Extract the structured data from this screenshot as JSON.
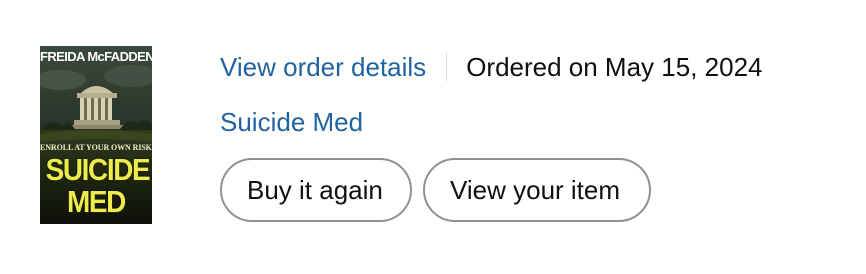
{
  "product": {
    "cover": {
      "author": "FREIDA McFADDEN",
      "tagline": "ENROLL AT YOUR OWN RISK...",
      "title_line1": "SUICIDE",
      "title_line2": "MED"
    },
    "title": "Suicide Med"
  },
  "order": {
    "details_link": "View order details",
    "ordered_on": "Ordered on May 15, 2024"
  },
  "actions": {
    "buy_again": "Buy it again",
    "view_item": "View your item"
  },
  "colors": {
    "link": "#2162a1",
    "text": "#0f1111",
    "button_border": "#8d9096",
    "divider": "#d5d9d9",
    "cover_title": "#ecec4a"
  }
}
